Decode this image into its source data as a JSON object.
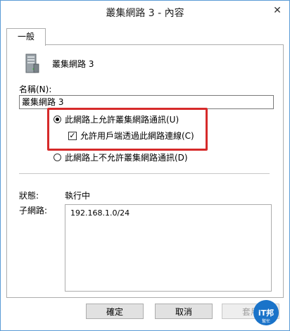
{
  "window": {
    "title": "叢集網路 3 - 內容"
  },
  "tabs": [
    {
      "label": "一般"
    }
  ],
  "general": {
    "network_name": "叢集網路 3",
    "name_label": "名稱(N):",
    "name_value": "叢集網路 3",
    "options": {
      "allow_cluster": "此網路上允許叢集網路通訊(U)",
      "allow_clients": "允許用戶端透過此網路連線(C)",
      "disallow_cluster": "此網路上不允許叢集網路通訊(D)"
    },
    "option_states": {
      "allow_cluster": true,
      "allow_clients": true,
      "disallow_cluster": false
    },
    "status_label": "狀態:",
    "status_value": "執行中",
    "subnet_label": "子網路:",
    "subnets": [
      "192.168.1.0/24"
    ]
  },
  "buttons": {
    "ok": "確定",
    "cancel": "取消",
    "apply": "套用"
  },
  "watermark": {
    "text": "iT邦幫忙"
  },
  "colors": {
    "highlight": "#d62a2a",
    "window_border": "#5a9bd5"
  }
}
